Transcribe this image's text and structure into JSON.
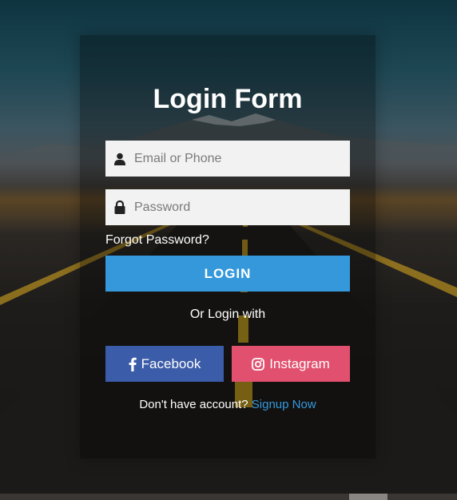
{
  "form": {
    "title": "Login Form",
    "email_placeholder": "Email or Phone",
    "password_placeholder": "Password",
    "forgot_label": "Forgot Password?",
    "login_label": "LOGIN",
    "or_label": "Or Login with",
    "facebook_label": "Facebook",
    "instagram_label": "Instagram",
    "no_account_label": "Don't have account?",
    "signup_label": "Signup Now"
  },
  "colors": {
    "accent": "#3498db",
    "facebook": "#3b5ca8",
    "instagram": "#e1506e",
    "input_bg": "#f2f2f2"
  },
  "icons": {
    "email": "user-icon",
    "password": "lock-icon",
    "facebook": "facebook-icon",
    "instagram": "instagram-icon"
  }
}
